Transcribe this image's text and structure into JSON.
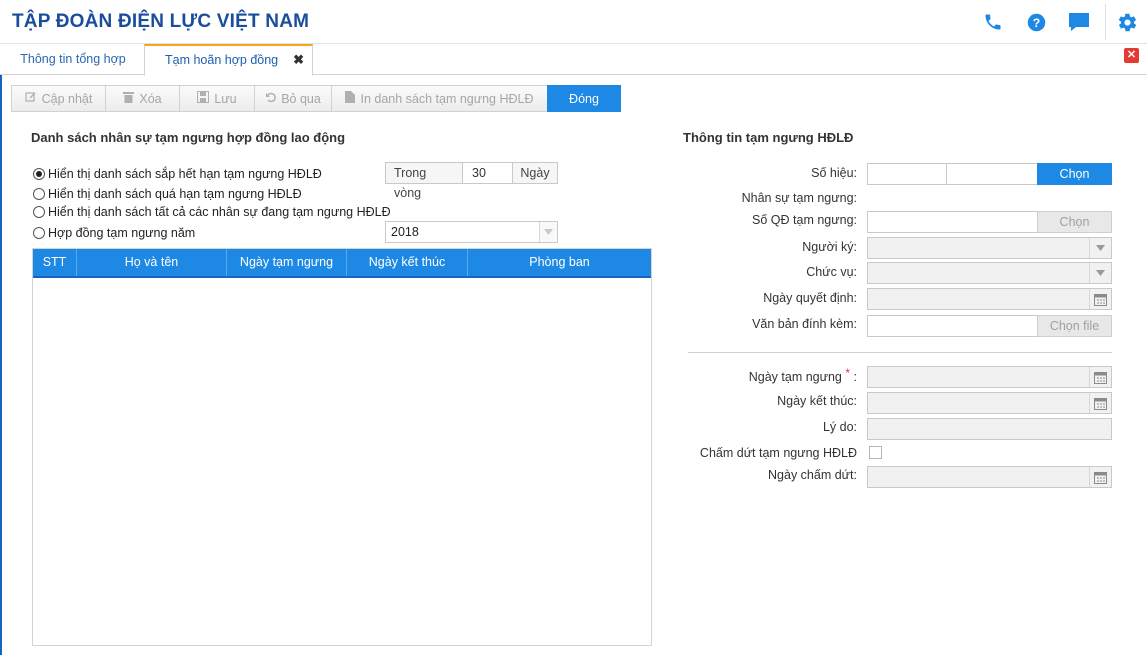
{
  "header": {
    "title": "TẬP ĐOÀN ĐIỆN LỰC VIỆT NAM",
    "icons": [
      "phone-icon",
      "help-icon",
      "chat-icon",
      "gear-icon"
    ],
    "accent_color": "#1e88e5",
    "title_color": "#1a4d9c"
  },
  "tabs": [
    {
      "label": "Thông tin tổng hợp",
      "active": false
    },
    {
      "label": "Tạm hoãn hợp đồng",
      "active": true,
      "close": "✖"
    }
  ],
  "close_all": "✕",
  "toolbar": {
    "update": "Cập nhật",
    "delete": "Xóa",
    "save": "Lưu",
    "skip": "Bỏ qua",
    "print": "In danh sách tạm ngưng HĐLĐ",
    "close": "Đóng"
  },
  "left": {
    "title": "Danh sách nhân sự tạm ngưng hợp đồng lao động",
    "options": [
      {
        "label": "Hiển thị danh sách sắp hết hạn tạm ngưng HĐLĐ",
        "checked": true
      },
      {
        "label": "Hiển thị danh sách quá hạn tạm ngưng HĐLĐ",
        "checked": false
      },
      {
        "label": "Hiển thị danh sách tất cả các nhân sự đang tạm ngưng HĐLĐ",
        "checked": false
      },
      {
        "label": "Hợp đồng tạm ngưng năm",
        "checked": false
      }
    ],
    "within_label": "Trong vòng",
    "within_value": "30",
    "within_unit": "Ngày",
    "year_value": "2018",
    "grid": {
      "columns": [
        "STT",
        "Họ và tên",
        "Ngày tạm ngưng",
        "Ngày kết thúc",
        "Phòng ban"
      ],
      "rows": []
    }
  },
  "right": {
    "title": "Thông tin tạm ngưng HĐLĐ",
    "so_hieu_label": "Số hiệu:",
    "so_hieu_btn": "Chọn",
    "nhan_su_label": "Nhân sự tạm ngưng:",
    "so_qd_label": "Số QĐ tạm ngưng:",
    "so_qd_btn": "Chọn",
    "nguoi_ky_label": "Người ký:",
    "chuc_vu_label": "Chức vụ:",
    "ngay_qd_label": "Ngày quyết định:",
    "van_ban_label": "Văn bản đính kèm:",
    "van_ban_btn": "Chọn file",
    "ngay_tam_ngung_label": "Ngày tạm ngưng",
    "required_mark": "*",
    "colon": ":",
    "ngay_ket_thuc_label": "Ngày kết thúc:",
    "ly_do_label": "Lý do:",
    "cham_dut_label": "Chấm dứt tạm ngưng HĐLĐ",
    "ngay_cham_dut_label": "Ngày chấm dứt:"
  }
}
